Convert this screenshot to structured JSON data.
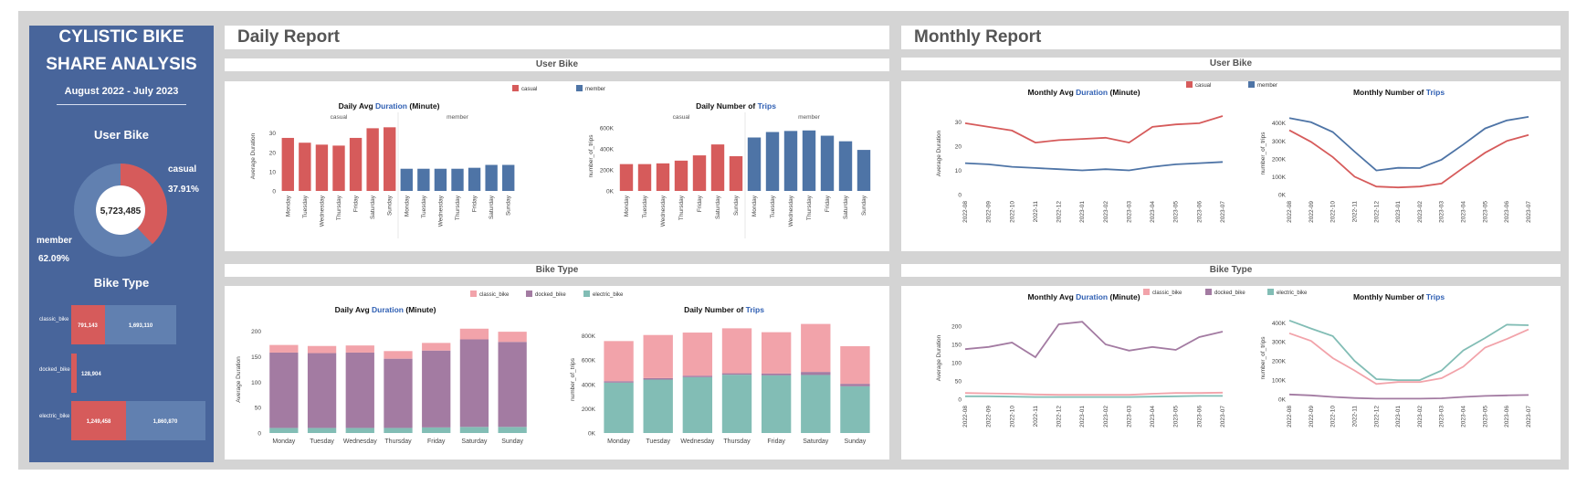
{
  "left": {
    "title_line1": "CYLISTIC BIKE",
    "title_line2": "SHARE ANALYSIS",
    "date_range": "August 2022 - July 2023",
    "user_bike_heading": "User Bike",
    "total": "5,723,485",
    "casual_label": "casual",
    "casual_pct": "37.91%",
    "member_label": "member",
    "member_pct": "62.09%",
    "bike_type_heading": "Bike Type",
    "bike_rows": [
      {
        "label": "classic_bike",
        "casual": "791,143",
        "member": "1,693,110"
      },
      {
        "label": "docked_bike",
        "casual": "128,904",
        "member": ""
      },
      {
        "label": "electric_bike",
        "casual": "1,249,458",
        "member": "1,860,870"
      }
    ]
  },
  "daily_header": "Daily Report",
  "monthly_header": "Monthly Report",
  "section_user": "User Bike",
  "section_type": "Bike Type",
  "colors": {
    "casual": "#d65b5b",
    "member": "#4e74a6",
    "classic": "#f2a3aa",
    "docked": "#a37ba2",
    "electric": "#82bdb5",
    "panel": "#48659b"
  },
  "chart_data": [
    {
      "id": "daily-user-duration",
      "type": "bar",
      "title": "Daily Avg |Duration| (Minute)",
      "xlabel": "",
      "ylabel": "Average Duration",
      "legend": [
        "casual",
        "member"
      ],
      "facets": [
        "casual",
        "member"
      ],
      "categories": [
        "Monday",
        "Tuesday",
        "Wednesday",
        "Thursday",
        "Friday",
        "Saturday",
        "Sunday"
      ],
      "series": [
        {
          "name": "casual",
          "values": [
            27.5,
            25,
            24,
            23.5,
            27.5,
            32.5,
            33
          ]
        },
        {
          "name": "member",
          "values": [
            11.5,
            11.5,
            11.5,
            11.5,
            12,
            13.5,
            13.5
          ]
        }
      ],
      "ylim": [
        0,
        36
      ],
      "yticks": [
        0,
        10,
        20,
        30
      ]
    },
    {
      "id": "daily-user-trips",
      "type": "bar",
      "title": "Daily Number of |Trips|",
      "xlabel": "",
      "ylabel": "number_of_trips",
      "facets": [
        "casual",
        "member"
      ],
      "categories": [
        "Monday",
        "Tuesday",
        "Wednesday",
        "Thursday",
        "Friday",
        "Saturday",
        "Sunday"
      ],
      "series": [
        {
          "name": "casual",
          "values": [
            255000,
            255000,
            262000,
            288000,
            338000,
            442000,
            330000
          ]
        },
        {
          "name": "member",
          "values": [
            508000,
            560000,
            570000,
            575000,
            525000,
            472000,
            390000
          ]
        }
      ],
      "ylim": [
        0,
        660000
      ],
      "yticks": [
        0,
        200000,
        400000,
        600000
      ],
      "yticklabels": [
        "0K",
        "200K",
        "400K",
        "600K"
      ]
    },
    {
      "id": "daily-type-duration",
      "type": "stacked-bar",
      "title": "Daily Avg |Duration| (Minute)",
      "xlabel": "",
      "ylabel": "Average Duration",
      "legend": [
        "classic_bike",
        "docked_bike",
        "electric_bike"
      ],
      "categories": [
        "Monday",
        "Tuesday",
        "Wednesday",
        "Thursday",
        "Friday",
        "Saturday",
        "Sunday"
      ],
      "series": [
        {
          "name": "electric_bike",
          "values": [
            10,
            10,
            10,
            10,
            11,
            12,
            12
          ]
        },
        {
          "name": "docked_bike",
          "values": [
            148,
            147,
            148,
            136,
            151,
            172,
            167
          ]
        },
        {
          "name": "classic_bike",
          "values": [
            15,
            14,
            14,
            15,
            15,
            21,
            20
          ]
        }
      ],
      "ylim": [
        0,
        210
      ],
      "yticks": [
        0,
        50,
        100,
        150,
        200
      ]
    },
    {
      "id": "daily-type-trips",
      "type": "stacked-bar",
      "title": "Daily Number of |Trips|",
      "xlabel": "",
      "ylabel": "number_of_trips",
      "categories": [
        "Monday",
        "Tuesday",
        "Wednesday",
        "Thursday",
        "Friday",
        "Saturday",
        "Sunday"
      ],
      "series": [
        {
          "name": "electric_bike",
          "values": [
            415000,
            440000,
            460000,
            480000,
            475000,
            478000,
            385000
          ]
        },
        {
          "name": "docked_bike",
          "values": [
            12000,
            12000,
            12000,
            12000,
            15000,
            25000,
            20000
          ]
        },
        {
          "name": "classic_bike",
          "values": [
            330000,
            355000,
            355000,
            370000,
            340000,
            395000,
            310000
          ]
        }
      ],
      "ylim": [
        0,
        880000
      ],
      "yticks": [
        0,
        200000,
        400000,
        600000,
        800000
      ],
      "yticklabels": [
        "0K",
        "200K",
        "400K",
        "600K",
        "800K"
      ]
    },
    {
      "id": "monthly-user-duration",
      "type": "line",
      "title": "Monthly Avg |Duration| (Minute)",
      "xlabel": "",
      "ylabel": "Average Duration",
      "legend": [
        "casual",
        "member"
      ],
      "categories": [
        "2022-08",
        "2022-09",
        "2022-10",
        "2022-11",
        "2022-12",
        "2023-01",
        "2023-02",
        "2023-03",
        "2023-04",
        "2023-05",
        "2023-06",
        "2023-07"
      ],
      "series": [
        {
          "name": "casual",
          "values": [
            29.5,
            28,
            26.5,
            21.5,
            22.5,
            23,
            23.5,
            21.5,
            28,
            29,
            29.5,
            32.5
          ]
        },
        {
          "name": "member",
          "values": [
            13,
            12.5,
            11.5,
            11,
            10.5,
            10,
            10.5,
            10,
            11.5,
            12.5,
            13,
            13.5
          ]
        }
      ],
      "ylim": [
        0,
        34
      ],
      "yticks": [
        0,
        10,
        20,
        30
      ]
    },
    {
      "id": "monthly-user-trips",
      "type": "line",
      "title": "Monthly Number of |Trips|",
      "xlabel": "",
      "ylabel": "number_of_trips",
      "categories": [
        "2022-08",
        "2022-09",
        "2022-10",
        "2022-11",
        "2022-12",
        "2023-01",
        "2023-02",
        "2023-03",
        "2023-04",
        "2023-05",
        "2023-06",
        "2023-07"
      ],
      "series": [
        {
          "name": "casual",
          "values": [
            360000,
            295000,
            210000,
            100000,
            45000,
            40000,
            45000,
            62000,
            150000,
            234000,
            300000,
            333000
          ]
        },
        {
          "name": "member",
          "values": [
            428000,
            405000,
            350000,
            240000,
            135000,
            150000,
            148000,
            195000,
            280000,
            370000,
            415000,
            435000
          ]
        }
      ],
      "ylim": [
        0,
        460000
      ],
      "yticks": [
        0,
        100000,
        200000,
        300000,
        400000
      ],
      "yticklabels": [
        "0K",
        "100K",
        "200K",
        "300K",
        "400K"
      ]
    },
    {
      "id": "monthly-type-duration",
      "type": "line",
      "title": "Monthly Avg |Duration| (Minute)",
      "xlabel": "",
      "ylabel": "Average Duration",
      "legend": [
        "classic_bike",
        "docked_bike",
        "electric_bike"
      ],
      "categories": [
        "2022-08",
        "2022-09",
        "2022-10",
        "2022-11",
        "2022-12",
        "2023-01",
        "2023-02",
        "2023-03",
        "2023-04",
        "2023-05",
        "2023-06",
        "2023-07"
      ],
      "series": [
        {
          "name": "classic_bike",
          "values": [
            17,
            16,
            15,
            13,
            12,
            12,
            12,
            12,
            15,
            17,
            17,
            18
          ]
        },
        {
          "name": "docked_bike",
          "values": [
            137,
            143,
            155,
            115,
            205,
            212,
            150,
            133,
            143,
            135,
            170,
            185
          ]
        },
        {
          "name": "electric_bike",
          "values": [
            8,
            8,
            7,
            6,
            6,
            6,
            6,
            6,
            7,
            8,
            9,
            9
          ]
        }
      ],
      "ylim": [
        0,
        225
      ],
      "yticks": [
        0,
        50,
        100,
        150,
        200
      ]
    },
    {
      "id": "monthly-type-trips",
      "type": "line",
      "title": "Monthly Number of |Trips|",
      "xlabel": "",
      "ylabel": "number_of_trips",
      "categories": [
        "2022-08",
        "2022-09",
        "2022-10",
        "2022-11",
        "2022-12",
        "2023-01",
        "2023-02",
        "2023-03",
        "2023-04",
        "2023-05",
        "2023-06",
        "2023-07"
      ],
      "series": [
        {
          "name": "classic_bike",
          "values": [
            345000,
            305000,
            215000,
            150000,
            80000,
            90000,
            90000,
            110000,
            170000,
            270000,
            315000,
            365000
          ]
        },
        {
          "name": "docked_bike",
          "values": [
            25000,
            20000,
            12000,
            6000,
            3000,
            3000,
            3000,
            5000,
            12000,
            17000,
            20000,
            22000
          ]
        },
        {
          "name": "electric_bike",
          "values": [
            412000,
            370000,
            330000,
            200000,
            105000,
            100000,
            100000,
            150000,
            255000,
            320000,
            390000,
            387000
          ]
        }
      ],
      "ylim": [
        0,
        430000
      ],
      "yticks": [
        0,
        100000,
        200000,
        300000,
        400000
      ],
      "yticklabels": [
        "0K",
        "100K",
        "200K",
        "300K",
        "400K"
      ]
    }
  ]
}
